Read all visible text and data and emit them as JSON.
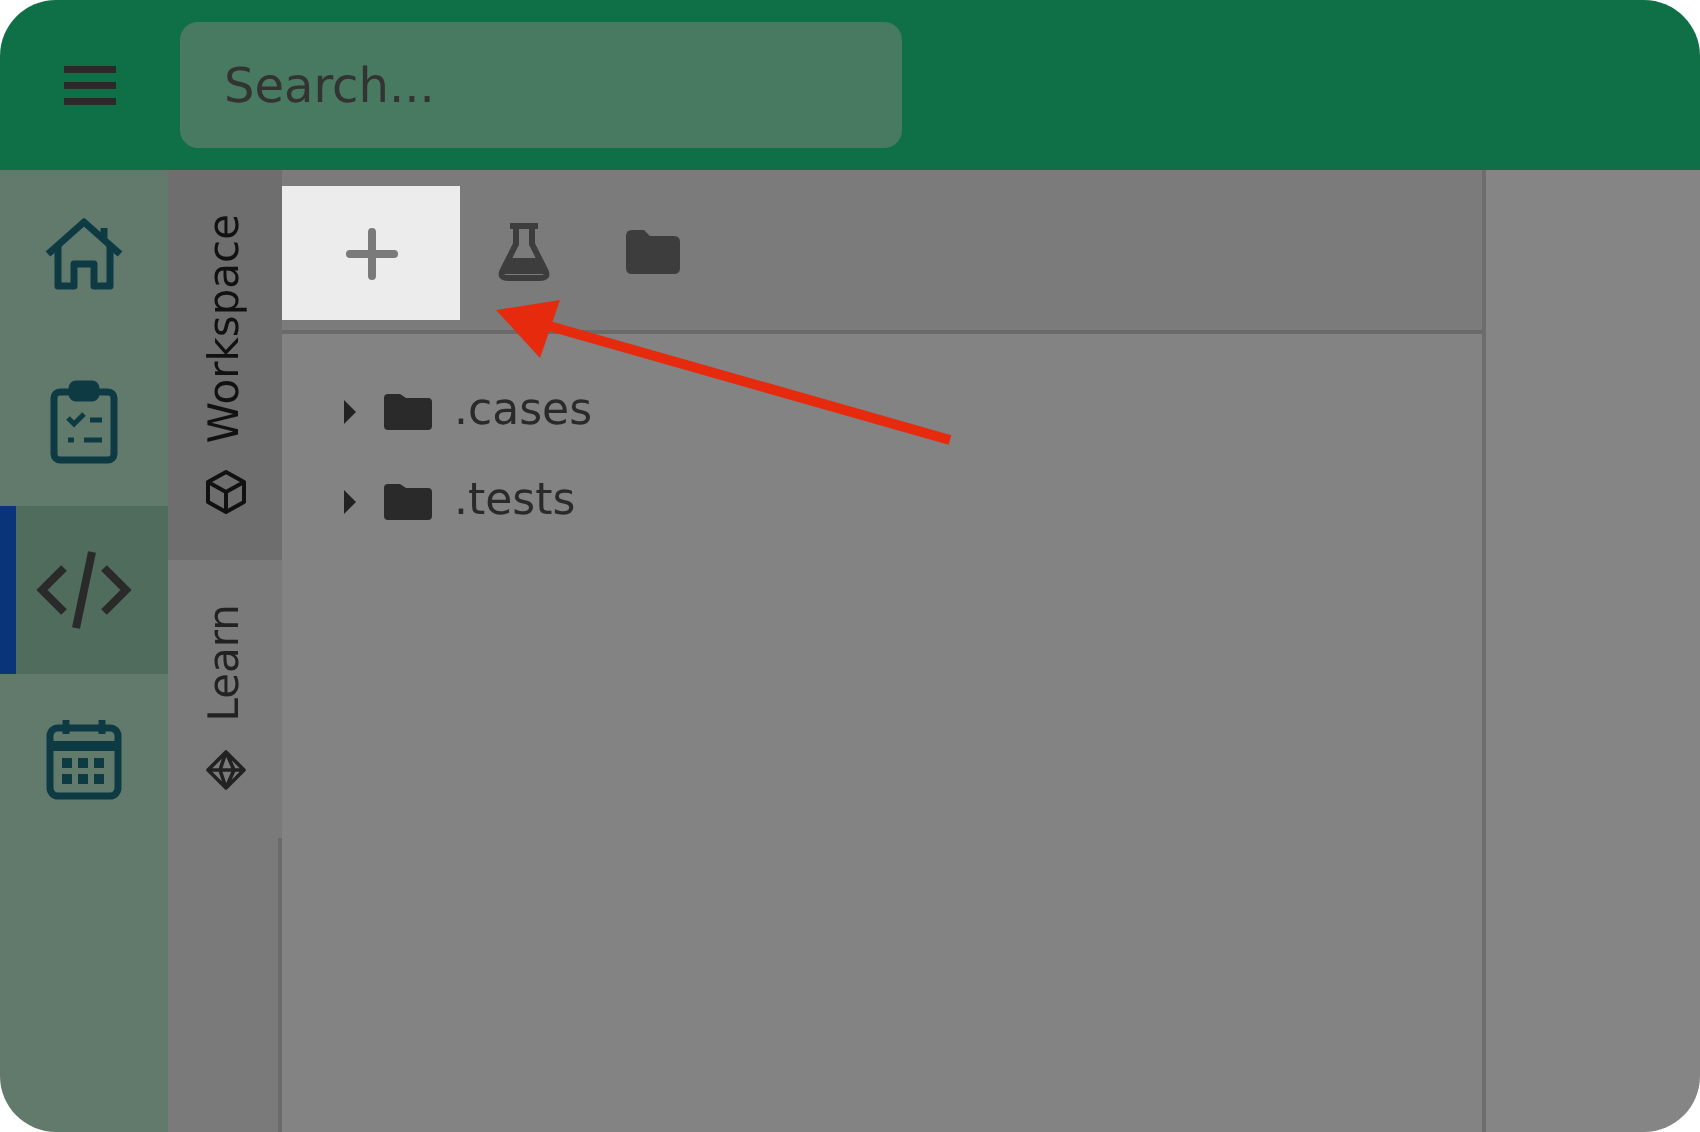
{
  "header": {
    "search": {
      "placeholder": "Search..."
    }
  },
  "rail": [
    {
      "selected": false
    },
    {
      "selected": false
    },
    {
      "selected": true
    },
    {
      "selected": false
    }
  ],
  "side_tabs": [
    {
      "label": "Workspace",
      "selected": true
    },
    {
      "label": "Learn",
      "selected": false
    }
  ],
  "toolbar": [
    {
      "selected": true
    },
    {
      "selected": false
    },
    {
      "selected": false
    }
  ],
  "tree": [
    {
      "label": ".cases",
      "expanded": false
    },
    {
      "label": ".tests",
      "expanded": false
    }
  ]
}
